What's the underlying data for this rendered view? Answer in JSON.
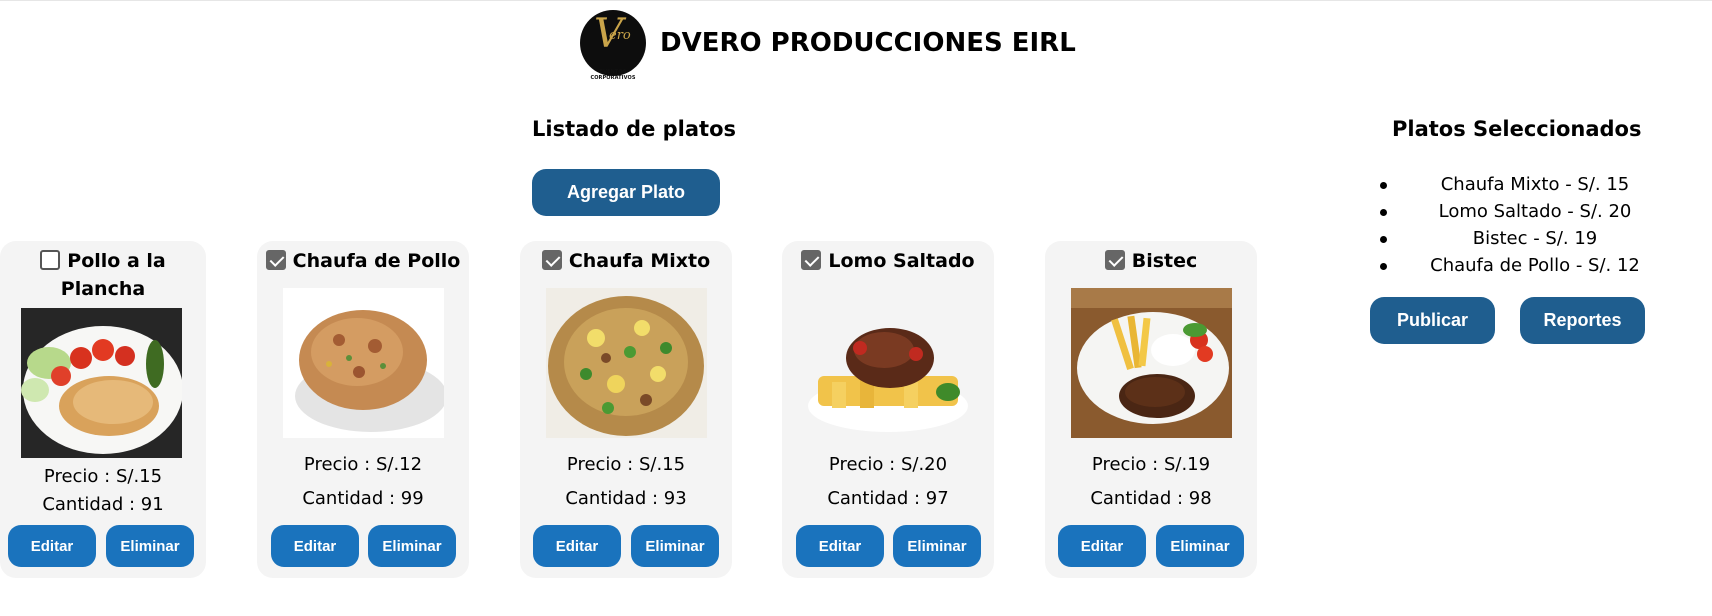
{
  "header": {
    "logo_mark": "V",
    "logo_word": "ero",
    "logo_caption": "EVENTOS CORPORATIVOS",
    "company": "DVERO PRODUCCIONES EIRL"
  },
  "list": {
    "title": "Listado de platos",
    "add_button": "Agregar Plato"
  },
  "dishes": [
    {
      "name": "Pollo a la Plancha",
      "checked": false,
      "price": "Precio : S/.15",
      "quantity": "Cantidad : 91",
      "edit": "Editar",
      "delete": "Eliminar"
    },
    {
      "name": "Chaufa de Pollo",
      "checked": true,
      "price": "Precio : S/.12",
      "quantity": "Cantidad : 99",
      "edit": "Editar",
      "delete": "Eliminar"
    },
    {
      "name": "Chaufa Mixto",
      "checked": true,
      "price": "Precio : S/.15",
      "quantity": "Cantidad : 93",
      "edit": "Editar",
      "delete": "Eliminar"
    },
    {
      "name": "Lomo Saltado",
      "checked": true,
      "price": "Precio : S/.20",
      "quantity": "Cantidad : 97",
      "edit": "Editar",
      "delete": "Eliminar"
    },
    {
      "name": "Bistec",
      "checked": true,
      "price": "Precio : S/.19",
      "quantity": "Cantidad : 98",
      "edit": "Editar",
      "delete": "Eliminar"
    }
  ],
  "selected": {
    "title": "Platos Seleccionados",
    "items": [
      "Chaufa Mixto - S/. 15",
      "Lomo Saltado - S/. 20",
      "Bistec - S/. 19",
      "Chaufa de Pollo - S/. 12"
    ],
    "publish_button": "Publicar",
    "reports_button": "Reportes"
  },
  "colors": {
    "primary_dark": "#1f5e8f",
    "primary": "#1a73bd",
    "card_bg": "#f4f4f4",
    "checkbox_checked": "#666666"
  }
}
